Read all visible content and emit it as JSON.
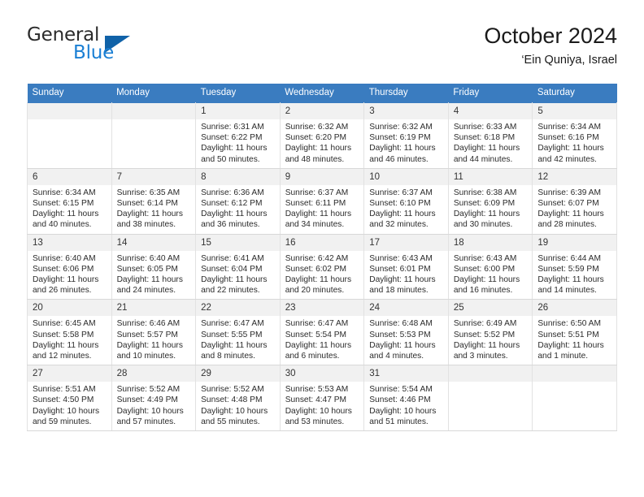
{
  "brand": {
    "name_part1": "General",
    "name_part2": "Blue",
    "triangle_icon": "triangle-icon"
  },
  "header": {
    "title": "October 2024",
    "location": "‘Ein Quniya, Israel"
  },
  "colors": {
    "header_blue": "#3a7cc0",
    "brand_blue": "#1a7fd4",
    "daynum_band": "#f1f1f1",
    "cell_border": "#e2e2e2"
  },
  "weekday_headers": [
    "Sunday",
    "Monday",
    "Tuesday",
    "Wednesday",
    "Thursday",
    "Friday",
    "Saturday"
  ],
  "weeks": [
    [
      {
        "day": "",
        "sunrise": "",
        "sunset": "",
        "daylight_line1": "",
        "daylight_line2": ""
      },
      {
        "day": "",
        "sunrise": "",
        "sunset": "",
        "daylight_line1": "",
        "daylight_line2": ""
      },
      {
        "day": "1",
        "sunrise": "Sunrise: 6:31 AM",
        "sunset": "Sunset: 6:22 PM",
        "daylight_line1": "Daylight: 11 hours",
        "daylight_line2": "and 50 minutes."
      },
      {
        "day": "2",
        "sunrise": "Sunrise: 6:32 AM",
        "sunset": "Sunset: 6:20 PM",
        "daylight_line1": "Daylight: 11 hours",
        "daylight_line2": "and 48 minutes."
      },
      {
        "day": "3",
        "sunrise": "Sunrise: 6:32 AM",
        "sunset": "Sunset: 6:19 PM",
        "daylight_line1": "Daylight: 11 hours",
        "daylight_line2": "and 46 minutes."
      },
      {
        "day": "4",
        "sunrise": "Sunrise: 6:33 AM",
        "sunset": "Sunset: 6:18 PM",
        "daylight_line1": "Daylight: 11 hours",
        "daylight_line2": "and 44 minutes."
      },
      {
        "day": "5",
        "sunrise": "Sunrise: 6:34 AM",
        "sunset": "Sunset: 6:16 PM",
        "daylight_line1": "Daylight: 11 hours",
        "daylight_line2": "and 42 minutes."
      }
    ],
    [
      {
        "day": "6",
        "sunrise": "Sunrise: 6:34 AM",
        "sunset": "Sunset: 6:15 PM",
        "daylight_line1": "Daylight: 11 hours",
        "daylight_line2": "and 40 minutes."
      },
      {
        "day": "7",
        "sunrise": "Sunrise: 6:35 AM",
        "sunset": "Sunset: 6:14 PM",
        "daylight_line1": "Daylight: 11 hours",
        "daylight_line2": "and 38 minutes."
      },
      {
        "day": "8",
        "sunrise": "Sunrise: 6:36 AM",
        "sunset": "Sunset: 6:12 PM",
        "daylight_line1": "Daylight: 11 hours",
        "daylight_line2": "and 36 minutes."
      },
      {
        "day": "9",
        "sunrise": "Sunrise: 6:37 AM",
        "sunset": "Sunset: 6:11 PM",
        "daylight_line1": "Daylight: 11 hours",
        "daylight_line2": "and 34 minutes."
      },
      {
        "day": "10",
        "sunrise": "Sunrise: 6:37 AM",
        "sunset": "Sunset: 6:10 PM",
        "daylight_line1": "Daylight: 11 hours",
        "daylight_line2": "and 32 minutes."
      },
      {
        "day": "11",
        "sunrise": "Sunrise: 6:38 AM",
        "sunset": "Sunset: 6:09 PM",
        "daylight_line1": "Daylight: 11 hours",
        "daylight_line2": "and 30 minutes."
      },
      {
        "day": "12",
        "sunrise": "Sunrise: 6:39 AM",
        "sunset": "Sunset: 6:07 PM",
        "daylight_line1": "Daylight: 11 hours",
        "daylight_line2": "and 28 minutes."
      }
    ],
    [
      {
        "day": "13",
        "sunrise": "Sunrise: 6:40 AM",
        "sunset": "Sunset: 6:06 PM",
        "daylight_line1": "Daylight: 11 hours",
        "daylight_line2": "and 26 minutes."
      },
      {
        "day": "14",
        "sunrise": "Sunrise: 6:40 AM",
        "sunset": "Sunset: 6:05 PM",
        "daylight_line1": "Daylight: 11 hours",
        "daylight_line2": "and 24 minutes."
      },
      {
        "day": "15",
        "sunrise": "Sunrise: 6:41 AM",
        "sunset": "Sunset: 6:04 PM",
        "daylight_line1": "Daylight: 11 hours",
        "daylight_line2": "and 22 minutes."
      },
      {
        "day": "16",
        "sunrise": "Sunrise: 6:42 AM",
        "sunset": "Sunset: 6:02 PM",
        "daylight_line1": "Daylight: 11 hours",
        "daylight_line2": "and 20 minutes."
      },
      {
        "day": "17",
        "sunrise": "Sunrise: 6:43 AM",
        "sunset": "Sunset: 6:01 PM",
        "daylight_line1": "Daylight: 11 hours",
        "daylight_line2": "and 18 minutes."
      },
      {
        "day": "18",
        "sunrise": "Sunrise: 6:43 AM",
        "sunset": "Sunset: 6:00 PM",
        "daylight_line1": "Daylight: 11 hours",
        "daylight_line2": "and 16 minutes."
      },
      {
        "day": "19",
        "sunrise": "Sunrise: 6:44 AM",
        "sunset": "Sunset: 5:59 PM",
        "daylight_line1": "Daylight: 11 hours",
        "daylight_line2": "and 14 minutes."
      }
    ],
    [
      {
        "day": "20",
        "sunrise": "Sunrise: 6:45 AM",
        "sunset": "Sunset: 5:58 PM",
        "daylight_line1": "Daylight: 11 hours",
        "daylight_line2": "and 12 minutes."
      },
      {
        "day": "21",
        "sunrise": "Sunrise: 6:46 AM",
        "sunset": "Sunset: 5:57 PM",
        "daylight_line1": "Daylight: 11 hours",
        "daylight_line2": "and 10 minutes."
      },
      {
        "day": "22",
        "sunrise": "Sunrise: 6:47 AM",
        "sunset": "Sunset: 5:55 PM",
        "daylight_line1": "Daylight: 11 hours",
        "daylight_line2": "and 8 minutes."
      },
      {
        "day": "23",
        "sunrise": "Sunrise: 6:47 AM",
        "sunset": "Sunset: 5:54 PM",
        "daylight_line1": "Daylight: 11 hours",
        "daylight_line2": "and 6 minutes."
      },
      {
        "day": "24",
        "sunrise": "Sunrise: 6:48 AM",
        "sunset": "Sunset: 5:53 PM",
        "daylight_line1": "Daylight: 11 hours",
        "daylight_line2": "and 4 minutes."
      },
      {
        "day": "25",
        "sunrise": "Sunrise: 6:49 AM",
        "sunset": "Sunset: 5:52 PM",
        "daylight_line1": "Daylight: 11 hours",
        "daylight_line2": "and 3 minutes."
      },
      {
        "day": "26",
        "sunrise": "Sunrise: 6:50 AM",
        "sunset": "Sunset: 5:51 PM",
        "daylight_line1": "Daylight: 11 hours",
        "daylight_line2": "and 1 minute."
      }
    ],
    [
      {
        "day": "27",
        "sunrise": "Sunrise: 5:51 AM",
        "sunset": "Sunset: 4:50 PM",
        "daylight_line1": "Daylight: 10 hours",
        "daylight_line2": "and 59 minutes."
      },
      {
        "day": "28",
        "sunrise": "Sunrise: 5:52 AM",
        "sunset": "Sunset: 4:49 PM",
        "daylight_line1": "Daylight: 10 hours",
        "daylight_line2": "and 57 minutes."
      },
      {
        "day": "29",
        "sunrise": "Sunrise: 5:52 AM",
        "sunset": "Sunset: 4:48 PM",
        "daylight_line1": "Daylight: 10 hours",
        "daylight_line2": "and 55 minutes."
      },
      {
        "day": "30",
        "sunrise": "Sunrise: 5:53 AM",
        "sunset": "Sunset: 4:47 PM",
        "daylight_line1": "Daylight: 10 hours",
        "daylight_line2": "and 53 minutes."
      },
      {
        "day": "31",
        "sunrise": "Sunrise: 5:54 AM",
        "sunset": "Sunset: 4:46 PM",
        "daylight_line1": "Daylight: 10 hours",
        "daylight_line2": "and 51 minutes."
      },
      {
        "day": "",
        "sunrise": "",
        "sunset": "",
        "daylight_line1": "",
        "daylight_line2": ""
      },
      {
        "day": "",
        "sunrise": "",
        "sunset": "",
        "daylight_line1": "",
        "daylight_line2": ""
      }
    ]
  ]
}
